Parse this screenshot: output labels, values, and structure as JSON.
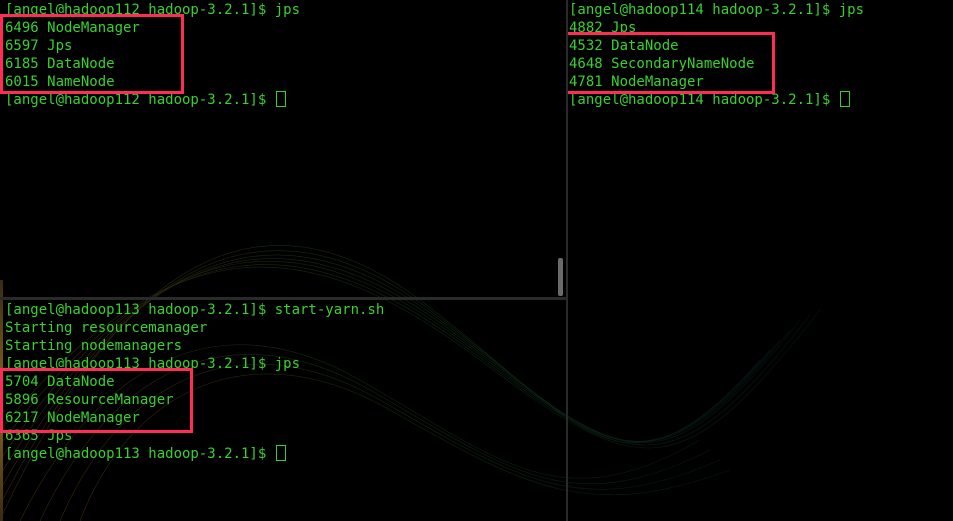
{
  "colors": {
    "text": "#39d02f",
    "highlight": "#ff2d55",
    "background": "#000000"
  },
  "panes": {
    "top_left": {
      "lines": [
        "[angel@hadoop112 hadoop-3.2.1]$ jps",
        "6496 NodeManager",
        "6597 Jps",
        "6185 DataNode",
        "6015 NameNode",
        "[angel@hadoop112 hadoop-3.2.1]$ "
      ]
    },
    "bottom_left": {
      "lines": [
        "[angel@hadoop113 hadoop-3.2.1]$ start-yarn.sh",
        "Starting resourcemanager",
        "Starting nodemanagers",
        "[angel@hadoop113 hadoop-3.2.1]$ jps",
        "5704 DataNode",
        "5896 ResourceManager",
        "6217 NodeManager",
        "6365 Jps",
        "[angel@hadoop113 hadoop-3.2.1]$ "
      ]
    },
    "right": {
      "lines": [
        "[angel@hadoop114 hadoop-3.2.1]$ jps",
        "4882 Jps",
        "4532 DataNode",
        "4648 SecondaryNameNode",
        "4781 NodeManager",
        "[angel@hadoop114 hadoop-3.2.1]$ "
      ]
    }
  }
}
